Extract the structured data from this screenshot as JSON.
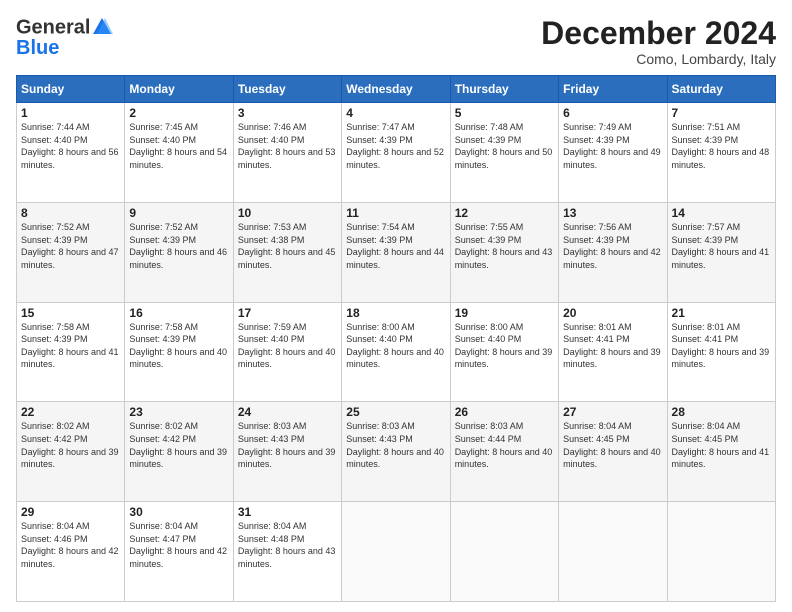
{
  "header": {
    "logo_line1": "General",
    "logo_line2": "Blue",
    "month": "December 2024",
    "location": "Como, Lombardy, Italy"
  },
  "days_of_week": [
    "Sunday",
    "Monday",
    "Tuesday",
    "Wednesday",
    "Thursday",
    "Friday",
    "Saturday"
  ],
  "weeks": [
    [
      {
        "day": "1",
        "sunrise": "Sunrise: 7:44 AM",
        "sunset": "Sunset: 4:40 PM",
        "daylight": "Daylight: 8 hours and 56 minutes."
      },
      {
        "day": "2",
        "sunrise": "Sunrise: 7:45 AM",
        "sunset": "Sunset: 4:40 PM",
        "daylight": "Daylight: 8 hours and 54 minutes."
      },
      {
        "day": "3",
        "sunrise": "Sunrise: 7:46 AM",
        "sunset": "Sunset: 4:40 PM",
        "daylight": "Daylight: 8 hours and 53 minutes."
      },
      {
        "day": "4",
        "sunrise": "Sunrise: 7:47 AM",
        "sunset": "Sunset: 4:39 PM",
        "daylight": "Daylight: 8 hours and 52 minutes."
      },
      {
        "day": "5",
        "sunrise": "Sunrise: 7:48 AM",
        "sunset": "Sunset: 4:39 PM",
        "daylight": "Daylight: 8 hours and 50 minutes."
      },
      {
        "day": "6",
        "sunrise": "Sunrise: 7:49 AM",
        "sunset": "Sunset: 4:39 PM",
        "daylight": "Daylight: 8 hours and 49 minutes."
      },
      {
        "day": "7",
        "sunrise": "Sunrise: 7:51 AM",
        "sunset": "Sunset: 4:39 PM",
        "daylight": "Daylight: 8 hours and 48 minutes."
      }
    ],
    [
      {
        "day": "8",
        "sunrise": "Sunrise: 7:52 AM",
        "sunset": "Sunset: 4:39 PM",
        "daylight": "Daylight: 8 hours and 47 minutes."
      },
      {
        "day": "9",
        "sunrise": "Sunrise: 7:52 AM",
        "sunset": "Sunset: 4:39 PM",
        "daylight": "Daylight: 8 hours and 46 minutes."
      },
      {
        "day": "10",
        "sunrise": "Sunrise: 7:53 AM",
        "sunset": "Sunset: 4:38 PM",
        "daylight": "Daylight: 8 hours and 45 minutes."
      },
      {
        "day": "11",
        "sunrise": "Sunrise: 7:54 AM",
        "sunset": "Sunset: 4:39 PM",
        "daylight": "Daylight: 8 hours and 44 minutes."
      },
      {
        "day": "12",
        "sunrise": "Sunrise: 7:55 AM",
        "sunset": "Sunset: 4:39 PM",
        "daylight": "Daylight: 8 hours and 43 minutes."
      },
      {
        "day": "13",
        "sunrise": "Sunrise: 7:56 AM",
        "sunset": "Sunset: 4:39 PM",
        "daylight": "Daylight: 8 hours and 42 minutes."
      },
      {
        "day": "14",
        "sunrise": "Sunrise: 7:57 AM",
        "sunset": "Sunset: 4:39 PM",
        "daylight": "Daylight: 8 hours and 41 minutes."
      }
    ],
    [
      {
        "day": "15",
        "sunrise": "Sunrise: 7:58 AM",
        "sunset": "Sunset: 4:39 PM",
        "daylight": "Daylight: 8 hours and 41 minutes."
      },
      {
        "day": "16",
        "sunrise": "Sunrise: 7:58 AM",
        "sunset": "Sunset: 4:39 PM",
        "daylight": "Daylight: 8 hours and 40 minutes."
      },
      {
        "day": "17",
        "sunrise": "Sunrise: 7:59 AM",
        "sunset": "Sunset: 4:40 PM",
        "daylight": "Daylight: 8 hours and 40 minutes."
      },
      {
        "day": "18",
        "sunrise": "Sunrise: 8:00 AM",
        "sunset": "Sunset: 4:40 PM",
        "daylight": "Daylight: 8 hours and 40 minutes."
      },
      {
        "day": "19",
        "sunrise": "Sunrise: 8:00 AM",
        "sunset": "Sunset: 4:40 PM",
        "daylight": "Daylight: 8 hours and 39 minutes."
      },
      {
        "day": "20",
        "sunrise": "Sunrise: 8:01 AM",
        "sunset": "Sunset: 4:41 PM",
        "daylight": "Daylight: 8 hours and 39 minutes."
      },
      {
        "day": "21",
        "sunrise": "Sunrise: 8:01 AM",
        "sunset": "Sunset: 4:41 PM",
        "daylight": "Daylight: 8 hours and 39 minutes."
      }
    ],
    [
      {
        "day": "22",
        "sunrise": "Sunrise: 8:02 AM",
        "sunset": "Sunset: 4:42 PM",
        "daylight": "Daylight: 8 hours and 39 minutes."
      },
      {
        "day": "23",
        "sunrise": "Sunrise: 8:02 AM",
        "sunset": "Sunset: 4:42 PM",
        "daylight": "Daylight: 8 hours and 39 minutes."
      },
      {
        "day": "24",
        "sunrise": "Sunrise: 8:03 AM",
        "sunset": "Sunset: 4:43 PM",
        "daylight": "Daylight: 8 hours and 39 minutes."
      },
      {
        "day": "25",
        "sunrise": "Sunrise: 8:03 AM",
        "sunset": "Sunset: 4:43 PM",
        "daylight": "Daylight: 8 hours and 40 minutes."
      },
      {
        "day": "26",
        "sunrise": "Sunrise: 8:03 AM",
        "sunset": "Sunset: 4:44 PM",
        "daylight": "Daylight: 8 hours and 40 minutes."
      },
      {
        "day": "27",
        "sunrise": "Sunrise: 8:04 AM",
        "sunset": "Sunset: 4:45 PM",
        "daylight": "Daylight: 8 hours and 40 minutes."
      },
      {
        "day": "28",
        "sunrise": "Sunrise: 8:04 AM",
        "sunset": "Sunset: 4:45 PM",
        "daylight": "Daylight: 8 hours and 41 minutes."
      }
    ],
    [
      {
        "day": "29",
        "sunrise": "Sunrise: 8:04 AM",
        "sunset": "Sunset: 4:46 PM",
        "daylight": "Daylight: 8 hours and 42 minutes."
      },
      {
        "day": "30",
        "sunrise": "Sunrise: 8:04 AM",
        "sunset": "Sunset: 4:47 PM",
        "daylight": "Daylight: 8 hours and 42 minutes."
      },
      {
        "day": "31",
        "sunrise": "Sunrise: 8:04 AM",
        "sunset": "Sunset: 4:48 PM",
        "daylight": "Daylight: 8 hours and 43 minutes."
      },
      null,
      null,
      null,
      null
    ]
  ]
}
